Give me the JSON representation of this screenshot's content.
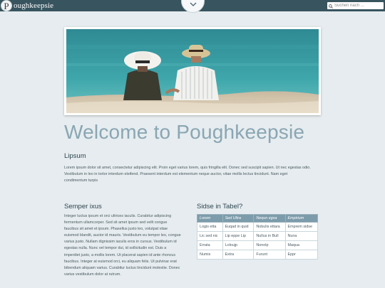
{
  "header": {
    "logo_letter": "P",
    "logo_text": "oughkeepsie",
    "search_placeholder": "Suchen nach ...",
    "colors": {
      "bar": "#38545f",
      "accent": "#8aa6b3"
    }
  },
  "page": {
    "title": "Welcome to Poughkeepsie"
  },
  "lipsum": {
    "heading": "Lipsum",
    "lines": [
      "Lorem ipsum dolor sit amet, consectetur adipiscing elit. Proin eget varius lorem, quis fringilla elit. Donec sed suscipit sapien. Ut nec egestas odio.",
      "Vestibulum in leo in tortor interdum eleifend. Praesent interdum est elementum neque auctor, vitae mollis lectus tincidunt. Nam eget",
      "condimentum turpis"
    ]
  },
  "semper": {
    "heading": "Semper ixus",
    "lines": [
      "Integer luctus ipsum et orci ultrices iaculis. Curabitur adipiscing",
      "fermentum ullamcorper. Sed sit amet ipsum sed velit congue",
      "faucibus sit amet et ipsum. Phasellus justo leo, volutpat vitae",
      "euismod blandit, auctor id mauris. Vestibulum eu tempor leo, congue",
      "varius justo. Nullam dignissim iaculis eros in cursus. Vestibulum id",
      "egestas nulla. Nunc vel tempor dui, id sollicitudin est. Duis a",
      "imperdiet justo, a mollis lorem. Ut placerat sapien id ante rhoncus",
      "faucibus. Integer at euismod orci, eu aliquam felis. Ut pulvinar erat",
      "bibendum aliquam varius. Curabitur luctus tincidunt molestie. Donec",
      "varius vestibulum dolor at rutrum."
    ]
  },
  "tabel": {
    "heading": "Sidse in Tabel?",
    "columns": [
      "Lorem",
      "Sed Ultra",
      "Nequn egsa",
      "Empirium"
    ],
    "rows": [
      [
        "Logis etta",
        "Euqad in quid",
        "Nobulis ettara",
        "Emprem sidse"
      ],
      [
        "Lic sed nic",
        "Lip eppe Lip",
        "Nullus in Bull",
        "Nuna"
      ],
      [
        "Errata",
        "Loloujp",
        "Nonolp",
        "Maqua"
      ],
      [
        "Numis",
        "Extra",
        "Furunt",
        "Eppr"
      ]
    ]
  }
}
